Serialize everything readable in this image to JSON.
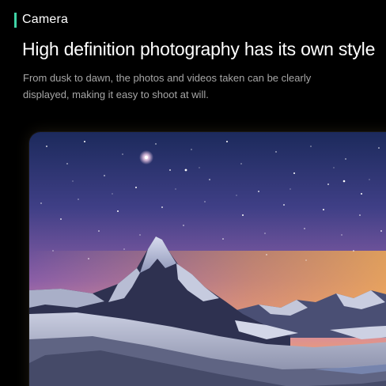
{
  "section": {
    "label": "Camera",
    "accent_color": "#3fd3a6"
  },
  "headline": "High definition photography has its own style",
  "description": "From dusk to dawn, the photos and videos taken can be clearly displayed, making it easy to shoot at will.",
  "photo": {
    "subject": "starry-night-mountain-peak",
    "sky_colors": [
      "#1e2b5e",
      "#6a4f9a",
      "#c97fb0",
      "#f0a060"
    ]
  }
}
